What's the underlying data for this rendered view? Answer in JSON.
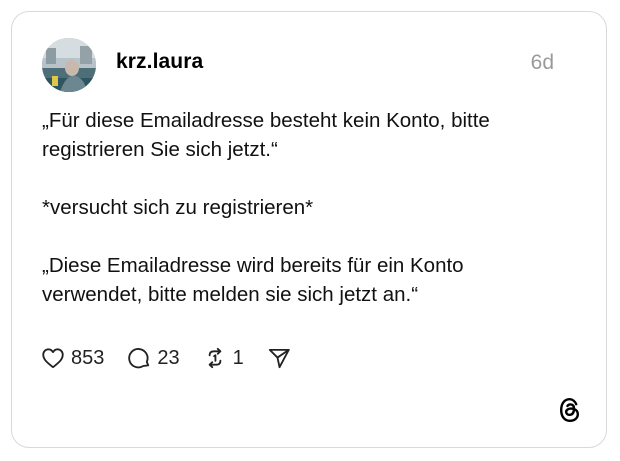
{
  "post": {
    "username": "krz.laura",
    "time": "6d",
    "paragraphs": [
      "„Für diese Emailadresse besteht kein Konto, bitte registrieren Sie sich jetzt.“",
      "*versucht sich zu registrieren*",
      "„Diese Emailadresse wird bereits für ein Konto verwendet, bitte melden sie sich jetzt an.“"
    ]
  },
  "actions": {
    "likes": "853",
    "replies": "23",
    "reposts": "1"
  },
  "icons": {
    "like": "heart-icon",
    "reply": "comment-icon",
    "repost": "repost-icon",
    "share": "send-icon",
    "brand": "threads-logo-icon"
  },
  "colors": {
    "border": "#d9d9d9",
    "muted": "#9a9a9a",
    "text": "#111111"
  }
}
